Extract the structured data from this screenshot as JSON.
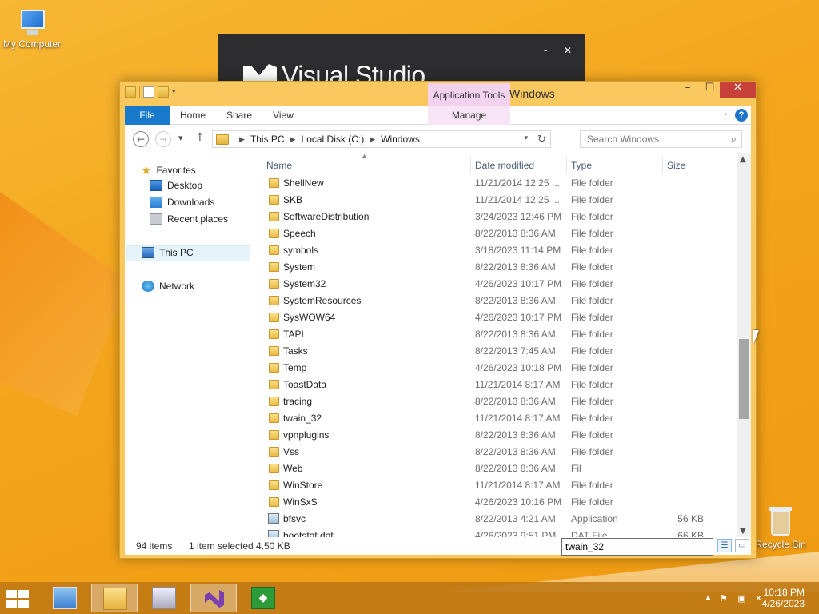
{
  "desktop": {
    "icons": [
      {
        "label": "My Computer"
      },
      {
        "label": "Recycle Bin"
      }
    ]
  },
  "vs_splash": {
    "title": "Visual Studio",
    "min_label": "-",
    "close_label": "✕"
  },
  "window": {
    "title": "Windows",
    "context_tab_group": "Application Tools",
    "controls": {
      "minimize": "–",
      "maximize": "☐",
      "close": "✕"
    },
    "ribbon_tabs": [
      "File",
      "Home",
      "Share",
      "View",
      "Manage"
    ],
    "help_label": "?",
    "address": {
      "crumbs": [
        "This PC",
        "Local Disk (C:)",
        "Windows"
      ]
    },
    "search": {
      "placeholder": "Search Windows"
    },
    "nav": {
      "favorites_label": "Favorites",
      "favorites": [
        "Desktop",
        "Downloads",
        "Recent places"
      ],
      "this_pc": "This PC",
      "network": "Network"
    },
    "columns": {
      "name": "Name",
      "date": "Date modified",
      "type": "Type",
      "size": "Size"
    },
    "files": [
      {
        "name": "ShellNew",
        "date": "11/21/2014 12:25 ...",
        "type": "File folder",
        "size": "",
        "kind": "folder"
      },
      {
        "name": "SKB",
        "date": "11/21/2014 12:25 ...",
        "type": "File folder",
        "size": "",
        "kind": "folder"
      },
      {
        "name": "SoftwareDistribution",
        "date": "3/24/2023 12:46 PM",
        "type": "File folder",
        "size": "",
        "kind": "folder"
      },
      {
        "name": "Speech",
        "date": "8/22/2013 8:36 AM",
        "type": "File folder",
        "size": "",
        "kind": "folder"
      },
      {
        "name": "symbols",
        "date": "3/18/2023 11:14 PM",
        "type": "File folder",
        "size": "",
        "kind": "folder"
      },
      {
        "name": "System",
        "date": "8/22/2013 8:36 AM",
        "type": "File folder",
        "size": "",
        "kind": "folder"
      },
      {
        "name": "System32",
        "date": "4/26/2023 10:17 PM",
        "type": "File folder",
        "size": "",
        "kind": "folder"
      },
      {
        "name": "SystemResources",
        "date": "8/22/2013 8:36 AM",
        "type": "File folder",
        "size": "",
        "kind": "folder"
      },
      {
        "name": "SysWOW64",
        "date": "4/26/2023 10:17 PM",
        "type": "File folder",
        "size": "",
        "kind": "folder"
      },
      {
        "name": "TAPI",
        "date": "8/22/2013 8:36 AM",
        "type": "File folder",
        "size": "",
        "kind": "folder"
      },
      {
        "name": "Tasks",
        "date": "8/22/2013 7:45 AM",
        "type": "File folder",
        "size": "",
        "kind": "folder"
      },
      {
        "name": "Temp",
        "date": "4/26/2023 10:18 PM",
        "type": "File folder",
        "size": "",
        "kind": "folder"
      },
      {
        "name": "ToastData",
        "date": "11/21/2014 8:17 AM",
        "type": "File folder",
        "size": "",
        "kind": "folder"
      },
      {
        "name": "tracing",
        "date": "8/22/2013 8:36 AM",
        "type": "File folder",
        "size": "",
        "kind": "folder"
      },
      {
        "name": "twain_32",
        "date": "11/21/2014 8:17 AM",
        "type": "File folder",
        "size": "",
        "kind": "folder"
      },
      {
        "name": "vpnplugins",
        "date": "8/22/2013 8:36 AM",
        "type": "File folder",
        "size": "",
        "kind": "folder"
      },
      {
        "name": "Vss",
        "date": "8/22/2013 8:36 AM",
        "type": "File folder",
        "size": "",
        "kind": "folder"
      },
      {
        "name": "Web",
        "date": "8/22/2013 8:36 AM",
        "type": "Fil",
        "size": "",
        "kind": "folder"
      },
      {
        "name": "WinStore",
        "date": "11/21/2014 8:17 AM",
        "type": "File folder",
        "size": "",
        "kind": "folder"
      },
      {
        "name": "WinSxS",
        "date": "4/26/2023 10:16 PM",
        "type": "File folder",
        "size": "",
        "kind": "folder"
      },
      {
        "name": "bfsvc",
        "date": "8/22/2013 4:21 AM",
        "type": "Application",
        "size": "56 KB",
        "kind": "app"
      },
      {
        "name": "bootstat.dat",
        "date": "4/26/2023 9:51 PM",
        "type": "DAT File",
        "size": "66 KB",
        "kind": "file"
      }
    ],
    "rename_value": "twain_32",
    "status": {
      "count": "94 items",
      "selected": "1 item selected",
      "size": "4.50 KB"
    }
  },
  "taskbar": {
    "time": "10:18 PM",
    "date": "4/26/2023"
  }
}
